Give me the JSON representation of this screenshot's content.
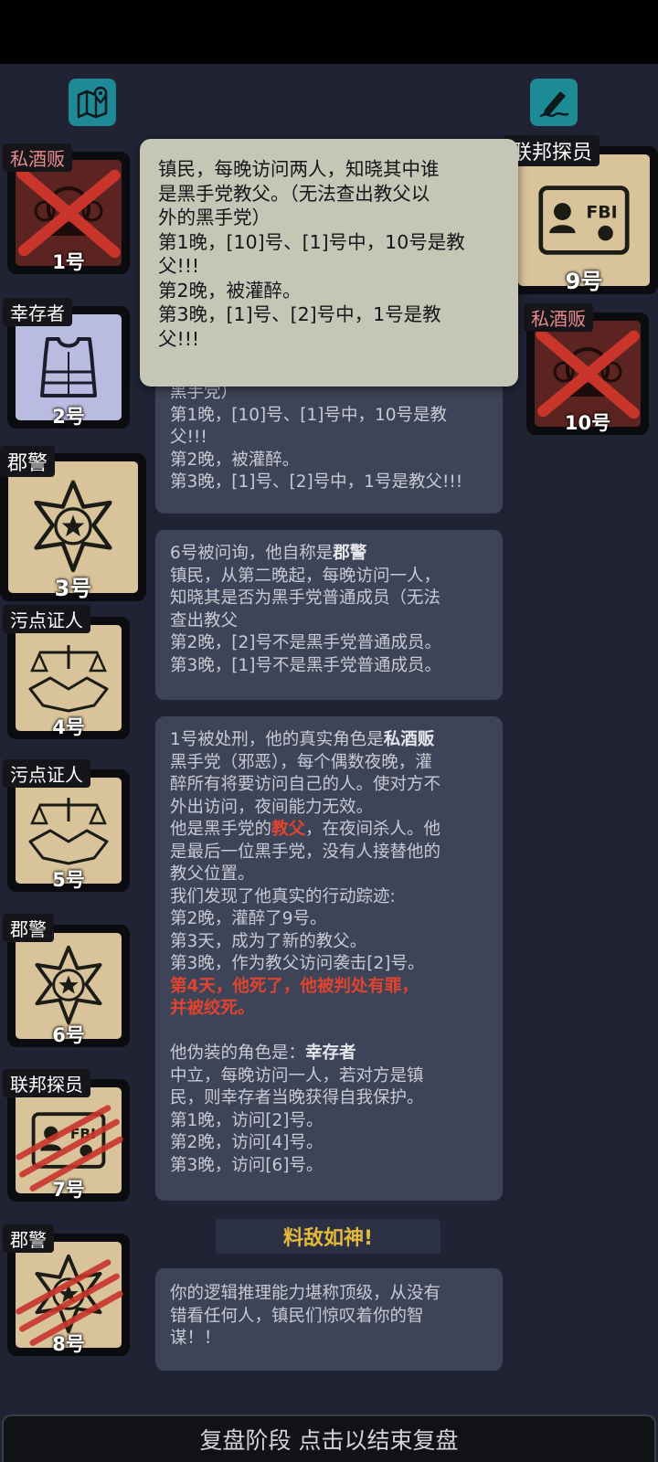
{
  "icons": {
    "map": "map-pin-icon",
    "notes": "pen-note-icon"
  },
  "players": [
    {
      "number": "1号",
      "role": "私酒贩",
      "role_color": "#e88a8a",
      "state": "executed-evil"
    },
    {
      "number": "2号",
      "role": "幸存者",
      "role_color": "#ffffff",
      "state": "alive"
    },
    {
      "number": "3号",
      "role": "郡警",
      "role_color": "#ffffff",
      "state": "alive"
    },
    {
      "number": "4号",
      "role": "污点证人",
      "role_color": "#ffffff",
      "state": "alive"
    },
    {
      "number": "5号",
      "role": "污点证人",
      "role_color": "#ffffff",
      "state": "alive"
    },
    {
      "number": "6号",
      "role": "郡警",
      "role_color": "#ffffff",
      "state": "alive"
    },
    {
      "number": "7号",
      "role": "联邦探员",
      "role_color": "#ffffff",
      "state": "killed"
    },
    {
      "number": "8号",
      "role": "郡警",
      "role_color": "#ffffff",
      "state": "killed"
    },
    {
      "number": "9号",
      "role": "联邦探员",
      "role_color": "#ffffff",
      "state": "self"
    },
    {
      "number": "10号",
      "role": "私酒贩",
      "role_color": "#e88a8a",
      "state": "executed-evil"
    }
  ],
  "tooltip": {
    "lines": [
      "镇民，每晚访问两人，知晓其中谁",
      "是黑手党教父。（无法查出教父以",
      "外的黑手党）",
      "第1晚，[10]号、[1]号中，10号是教",
      "父!!!",
      "第2晚，被灌醉。",
      "第3晚，[1]号、[2]号中，1号是教",
      "父!!!"
    ]
  },
  "log": {
    "panel1": {
      "lines": [
        "黑手党）",
        "第1晚，[10]号、[1]号中，10号是教",
        "父!!!",
        "第2晚，被灌醉。",
        "第3晚，[1]号、[2]号中，1号是教父!!!"
      ]
    },
    "panel2": {
      "head_prefix": "6号被问询，他自称是",
      "head_role": "郡警",
      "lines": [
        "镇民，从第二晚起，每晚访问一人，",
        "知晓其是否为黑手党普通成员（无法",
        "查出教父",
        "第2晚，[2]号不是黑手党普通成员。",
        "第3晚，[1]号不是黑手党普通成员。"
      ]
    },
    "panel3": {
      "head_prefix": "1号被处刑，他的真实角色是",
      "head_role": "私酒贩",
      "lines_a": [
        "黑手党（邪恶），每个偶数夜晚，灌",
        "醉所有将要访问自己的人。使对方不",
        "外出访问，夜间能力无效。"
      ],
      "godfather_prefix": "他是黑手党的",
      "godfather_word": "教父",
      "godfather_suffix": "，在夜间杀人。他",
      "lines_b": [
        "是最后一位黑手党，没有人接替他的",
        "教父位置。",
        "我们发现了他真实的行动踪迹:",
        "第2晚，灌醉了9号。",
        "第3天，成为了新的教父。",
        "第3晚，作为教父访问袭击[2]号。"
      ],
      "death_lines": [
        "第4天，他死了，他被判处有罪，",
        "并被绞死。"
      ],
      "disguise_prefix": "他伪装的角色是：",
      "disguise_role": "幸存者",
      "lines_c": [
        "中立，每晚访问一人，若对方是镇",
        "民，则幸存者当晚获得自我保护。",
        "第1晚，访问[2]号。",
        "第2晚，访问[4]号。",
        "第3晚，访问[6]号。"
      ]
    },
    "banner": "料敌如神!",
    "panel4": {
      "lines": [
        "你的逻辑推理能力堪称顶级，从没有",
        "错看任何人，镇民们惊叹着你的智",
        "谋！！"
      ]
    }
  },
  "bottom_bar": "复盘阶段 点击以结束复盘",
  "colors": {
    "card_tan": "#d8c39a",
    "card_red": "#5c2420",
    "card_lilac": "#babbe0",
    "x_red": "#c9352b",
    "accent_teal": "#1e8a96",
    "gold": "#e4b93a"
  }
}
